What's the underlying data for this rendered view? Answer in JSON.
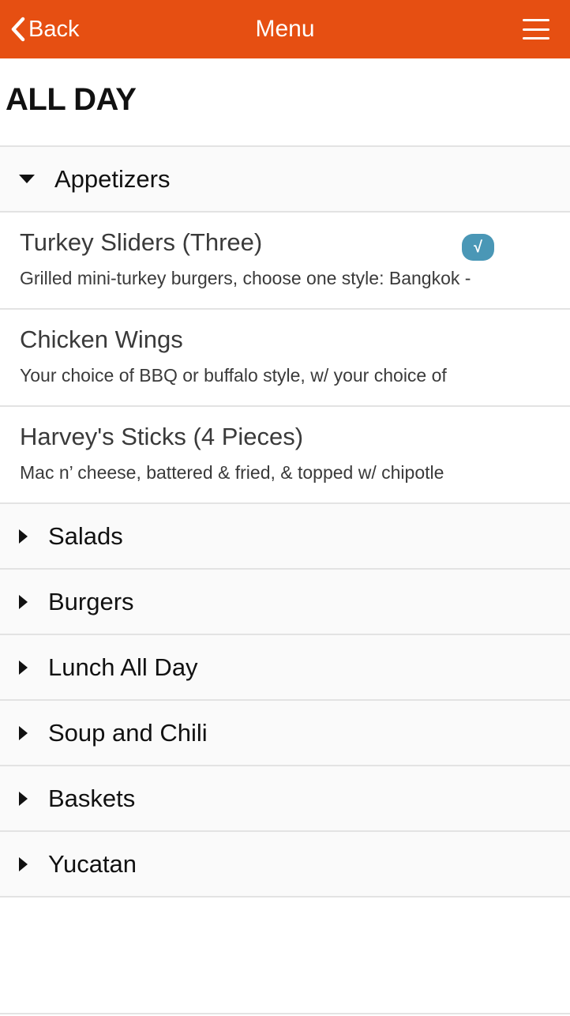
{
  "header": {
    "back_label": "Back",
    "title": "Menu",
    "back_icon": "chevron-left-icon",
    "menu_icon": "hamburger-menu-icon",
    "background": "#e64f12"
  },
  "page": {
    "title": "ALL DAY"
  },
  "categories": {
    "expanded": {
      "label": "Appetizers",
      "items": [
        {
          "name": "Turkey Sliders (Three)",
          "description": "Grilled mini-turkey burgers, choose one style: Bangkok -",
          "badge": "√"
        },
        {
          "name": "Chicken Wings",
          "description": "Your choice of BBQ or buffalo style, w/ your choice of"
        },
        {
          "name": "Harvey's Sticks (4 Pieces)",
          "description": "Mac n’ cheese, battered & fried, & topped w/ chipotle"
        }
      ]
    },
    "collapsed": [
      {
        "label": "Salads"
      },
      {
        "label": "Burgers"
      },
      {
        "label": "Lunch All Day"
      },
      {
        "label": "Soup and Chili"
      },
      {
        "label": "Baskets"
      },
      {
        "label": "Yucatan"
      }
    ]
  },
  "colors": {
    "accent": "#e64f12",
    "badge": "#4a97b6",
    "divider": "#e3e3e3"
  }
}
